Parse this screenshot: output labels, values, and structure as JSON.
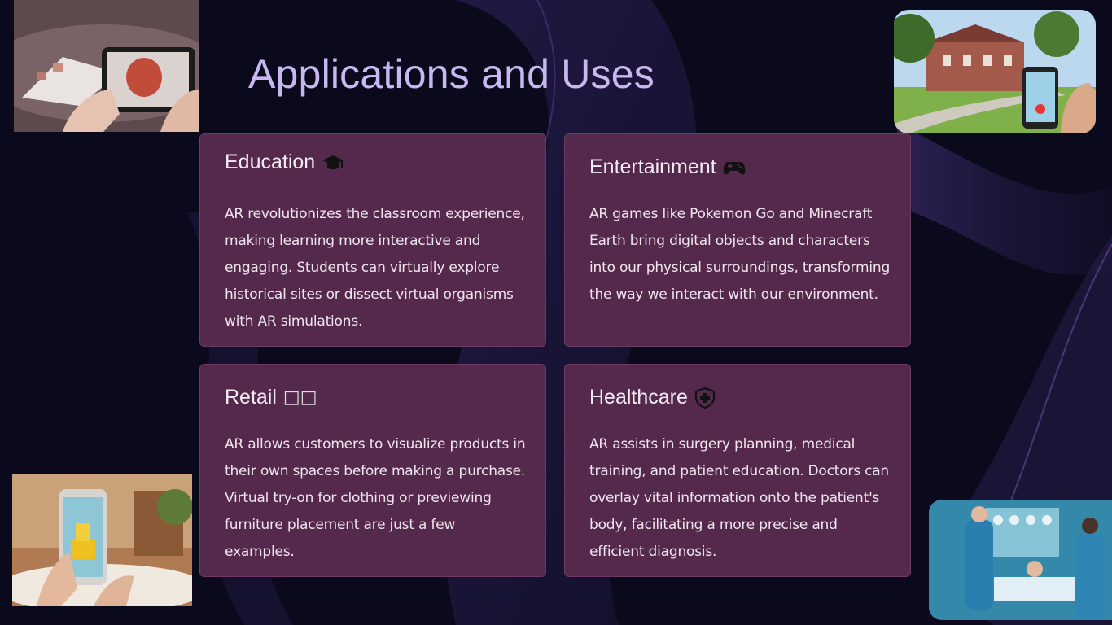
{
  "slide": {
    "title": "Applications and Uses"
  },
  "cards": [
    {
      "heading": "Education",
      "icon": "graduation-cap-icon",
      "text": "AR revolutionizes the classroom experience, making learning more interactive and engaging. Students can virtually explore historical sites or dissect virtual organisms with AR simulations."
    },
    {
      "heading": "Entertainment",
      "icon": "gamepad-icon",
      "text": "AR games like Pokemon Go and Minecraft Earth bring digital objects and characters into our physical surroundings, transforming the way we interact with our environment."
    },
    {
      "heading": "Retail",
      "icon": "missing-glyph-boxes",
      "icon_glyph": "□□",
      "text": "AR allows customers to visualize products in their own spaces before making a purchase. Virtual try-on for clothing or previewing furniture placement are just a few examples."
    },
    {
      "heading": "Healthcare",
      "icon": "shield-plus-icon",
      "text": "AR assists in surgery planning, medical training, and patient education. Doctors can overlay vital information onto the patient's body, facilitating a more precise and efficient diagnosis."
    }
  ],
  "colors": {
    "background": "#0b0b1e",
    "card": "#55294c",
    "title": "#c9b8f0",
    "text": "#efe6ee"
  }
}
